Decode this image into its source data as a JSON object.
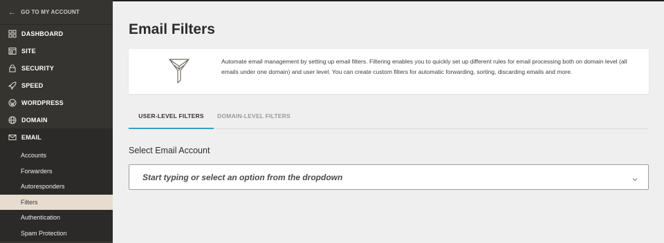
{
  "sidebar": {
    "back_label": "GO TO MY ACCOUNT",
    "items": [
      {
        "label": "DASHBOARD",
        "icon": "dashboard-icon"
      },
      {
        "label": "SITE",
        "icon": "site-icon"
      },
      {
        "label": "SECURITY",
        "icon": "lock-icon"
      },
      {
        "label": "SPEED",
        "icon": "rocket-icon"
      },
      {
        "label": "WORDPRESS",
        "icon": "wordpress-icon"
      },
      {
        "label": "DOMAIN",
        "icon": "globe-icon"
      },
      {
        "label": "EMAIL",
        "icon": "envelope-icon"
      }
    ],
    "email_sub": [
      "Accounts",
      "Forwarders",
      "Autoresponders",
      "Filters",
      "Authentication",
      "Spam Protection"
    ],
    "active_sub": "Filters"
  },
  "main": {
    "title": "Email Filters",
    "info_text": "Automate email management by setting up email filters. Filtering enables you to quickly set up different rules for email processing both on domain level (all emails under one domain) and user level. You can create custom filters for automatic forwarding, sorting, discarding emails and more.",
    "tabs": [
      {
        "label": "USER-LEVEL FILTERS",
        "active": true
      },
      {
        "label": "DOMAIN-LEVEL FILTERS",
        "active": false
      }
    ],
    "select_label": "Select Email Account",
    "select_placeholder": "Start typing or select an option from the dropdown"
  },
  "colors": {
    "sidebar_bg": "#363431",
    "active_sub_bg": "#e6dccf",
    "tab_accent": "#35a0c7"
  }
}
